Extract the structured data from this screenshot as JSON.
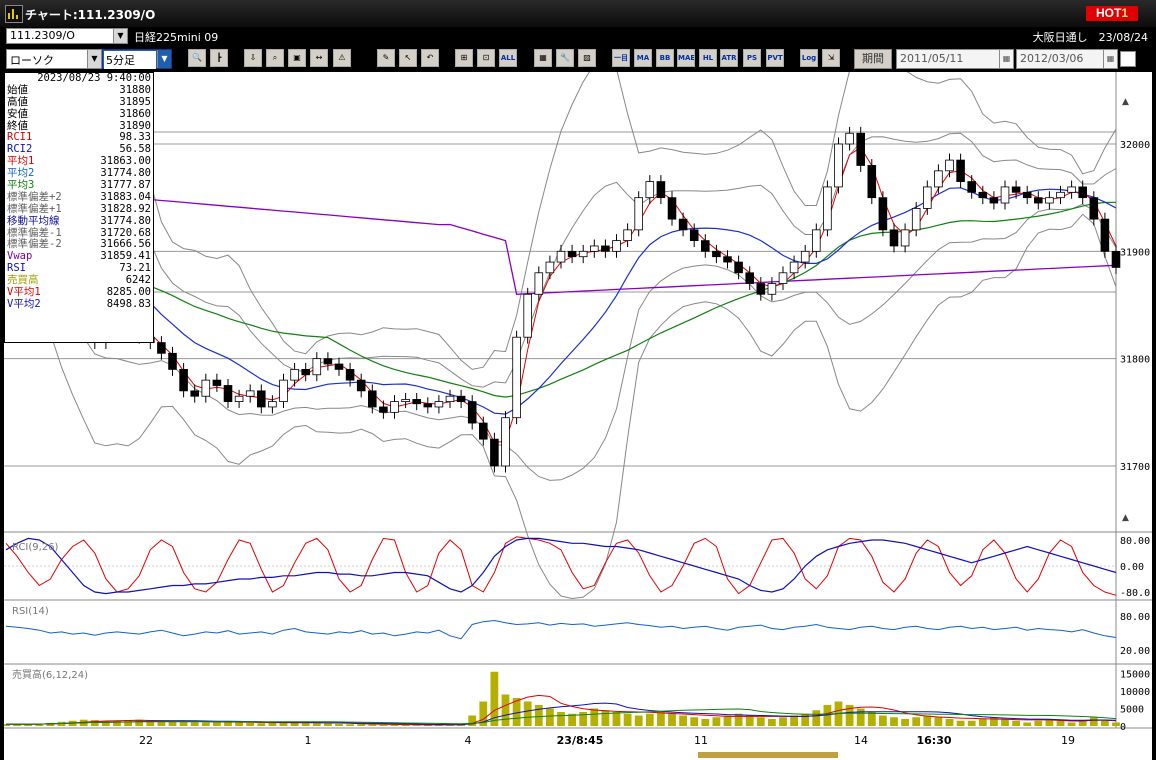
{
  "window": {
    "title": "チャート:111.2309/O",
    "hot_badge": {
      "text": "HOT",
      "number": "1"
    }
  },
  "symbol_bar": {
    "symbol": "111.2309/O",
    "name": "日経225mini 09",
    "exchange_date": "大阪日通し　23/08/24"
  },
  "toolbar": {
    "chart_type": "ローソク",
    "interval": "5分足",
    "period_label": "期間",
    "date_from": "2011/05/11",
    "date_to": "2012/03/06",
    "buttons": [
      {
        "name": "zoom-icon",
        "glyph": "🔍",
        "text": ""
      },
      {
        "name": "split-icon",
        "glyph": "┣",
        "text": ""
      },
      {
        "name": "download-icon",
        "glyph": "⇩",
        "text": ""
      },
      {
        "name": "search-chart-icon",
        "glyph": "⌕",
        "text": ""
      },
      {
        "name": "compare-icon",
        "glyph": "▣",
        "text": ""
      },
      {
        "name": "arrows-icon",
        "glyph": "↔",
        "text": ""
      },
      {
        "name": "warning-icon",
        "glyph": "⚠",
        "text": ""
      },
      {
        "name": "pencil-icon",
        "glyph": "✎",
        "text": ""
      },
      {
        "name": "cursor-icon",
        "glyph": "↖",
        "text": ""
      },
      {
        "name": "undo-icon",
        "glyph": "↶",
        "text": ""
      },
      {
        "name": "candle-a-icon",
        "glyph": "⊞",
        "text": ""
      },
      {
        "name": "candle-b-icon",
        "glyph": "⊡",
        "text": ""
      },
      {
        "name": "all-icon",
        "glyph": "",
        "text": "ALL"
      },
      {
        "name": "grid-icon",
        "glyph": "▦",
        "text": ""
      },
      {
        "name": "tools-icon",
        "glyph": "🔧",
        "text": ""
      },
      {
        "name": "palette-icon",
        "glyph": "▨",
        "text": ""
      },
      {
        "name": "indicator-icon",
        "glyph": "",
        "text": "一目"
      },
      {
        "name": "ma-icon",
        "glyph": "",
        "text": "MA"
      },
      {
        "name": "bb-icon",
        "glyph": "",
        "text": "BB"
      },
      {
        "name": "mae-icon",
        "glyph": "",
        "text": "MAE"
      },
      {
        "name": "hl-icon",
        "glyph": "",
        "text": "HL"
      },
      {
        "name": "atr-icon",
        "glyph": "",
        "text": "ATR"
      },
      {
        "name": "psar-icon",
        "glyph": "",
        "text": "PS"
      },
      {
        "name": "pvt-icon",
        "glyph": "",
        "text": "PVT"
      },
      {
        "name": "log-icon",
        "glyph": "",
        "text": "Log"
      },
      {
        "name": "export-icon",
        "glyph": "⇲",
        "text": ""
      }
    ]
  },
  "info_panel": {
    "datetime": "2023/08/23 9:40:00",
    "rows": [
      {
        "label": "始値",
        "value": "31880",
        "color": "#000000"
      },
      {
        "label": "高値",
        "value": "31895",
        "color": "#000000"
      },
      {
        "label": "安値",
        "value": "31860",
        "color": "#000000"
      },
      {
        "label": "終値",
        "value": "31890",
        "color": "#000000"
      },
      {
        "label": "RCI1",
        "value": "98.33",
        "color": "#e00000"
      },
      {
        "label": "RCI2",
        "value": "56.58",
        "color": "#1010c0"
      },
      {
        "label": "平均1",
        "value": "31863.00",
        "color": "#e00000"
      },
      {
        "label": "平均2",
        "value": "31774.80",
        "color": "#1060d0"
      },
      {
        "label": "平均3",
        "value": "31777.87",
        "color": "#108010"
      },
      {
        "label": "標準偏差+2",
        "value": "31883.04",
        "color": "#606060"
      },
      {
        "label": "標準偏差+1",
        "value": "31828.92",
        "color": "#606060"
      },
      {
        "label": "移動平均線",
        "value": "31774.80",
        "color": "#1010a0"
      },
      {
        "label": "標準偏差-1",
        "value": "31720.68",
        "color": "#606060"
      },
      {
        "label": "標準偏差-2",
        "value": "31666.56",
        "color": "#606060"
      },
      {
        "label": "Vwap",
        "value": "31859.41",
        "color": "#8000a0"
      },
      {
        "label": "RSI",
        "value": "73.21",
        "color": "#1010c0"
      },
      {
        "label": "売買高",
        "value": "6242",
        "color": "#a0a000"
      },
      {
        "label": "V平均1",
        "value": "8285.00",
        "color": "#e00000"
      },
      {
        "label": "V平均2",
        "value": "8498.83",
        "color": "#1010c0"
      }
    ]
  },
  "panels": {
    "rci_label": "RCI(9,26)",
    "rsi_label": "RSI(14)",
    "volume_label": "売買高(6,12,24)"
  },
  "axes": {
    "price_ticks": [
      "32000",
      "31900",
      "31800",
      "31700"
    ],
    "rci_ticks": [
      "80.00",
      "0.00",
      "-80.0"
    ],
    "rsi_ticks": [
      "80.00",
      "20.00"
    ],
    "volume_ticks": [
      "15000",
      "10000",
      "5000",
      "0"
    ],
    "time_labels": [
      {
        "text": "22",
        "bold": false
      },
      {
        "text": "1",
        "bold": false
      },
      {
        "text": "4",
        "bold": false
      },
      {
        "text": "23/8:45",
        "bold": true
      },
      {
        "text": "11",
        "bold": false
      },
      {
        "text": "14",
        "bold": false
      },
      {
        "text": "16:30",
        "bold": true
      },
      {
        "text": "19",
        "bold": false
      }
    ]
  },
  "chart_data": {
    "type": "candlestick",
    "ylim": [
      31660,
      32070
    ],
    "price_close_path": [
      31965,
      31955,
      31935,
      31900,
      31880,
      31860,
      31845,
      31830,
      31815,
      31840,
      31850,
      31835,
      31820,
      31815,
      31805,
      31790,
      31770,
      31765,
      31780,
      31775,
      31760,
      31765,
      31770,
      31755,
      31760,
      31780,
      31790,
      31785,
      31800,
      31795,
      31790,
      31780,
      31770,
      31755,
      31750,
      31760,
      31762,
      31758,
      31755,
      31760,
      31765,
      31760,
      31740,
      31725,
      31700,
      31745,
      31820,
      31860,
      31880,
      31890,
      31900,
      31895,
      31900,
      31905,
      31900,
      31910,
      31920,
      31950,
      31965,
      31950,
      31930,
      31920,
      31910,
      31900,
      31895,
      31890,
      31880,
      31870,
      31860,
      31870,
      31880,
      31890,
      31900,
      31920,
      31960,
      32000,
      32010,
      31980,
      31950,
      31920,
      31905,
      31920,
      31940,
      31960,
      31975,
      31985,
      31965,
      31955,
      31950,
      31945,
      31960,
      31955,
      31950,
      31945,
      31950,
      31955,
      31960,
      31950,
      31930,
      31900,
      31885
    ],
    "volume_path": [
      500,
      600,
      400,
      700,
      900,
      1200,
      1500,
      1800,
      1700,
      1400,
      1500,
      1600,
      1800,
      1500,
      1400,
      1300,
      1200,
      1100,
      1000,
      1100,
      1200,
      1000,
      900,
      800,
      900,
      1000,
      1100,
      900,
      800,
      700,
      600,
      500,
      500,
      400,
      300,
      400,
      300,
      200,
      300,
      400,
      300,
      500,
      3000,
      7000,
      15500,
      9000,
      8000,
      7000,
      6000,
      5000,
      4000,
      3500,
      4000,
      5000,
      4500,
      4000,
      3500,
      3000,
      3500,
      4000,
      3500,
      3000,
      2500,
      2000,
      2500,
      3000,
      3500,
      3000,
      2500,
      2000,
      2500,
      3000,
      3500,
      4500,
      6000,
      7000,
      6000,
      5000,
      4000,
      3000,
      2500,
      2000,
      2500,
      3000,
      2500,
      2000,
      1500,
      1500,
      2000,
      2500,
      2000,
      1500,
      1000,
      1500,
      2000,
      1500,
      1000,
      1500,
      2500,
      1500,
      1000
    ],
    "rsi_path": [
      62,
      60,
      58,
      55,
      50,
      52,
      48,
      50,
      46,
      50,
      52,
      50,
      48,
      52,
      55,
      50,
      45,
      48,
      52,
      50,
      54,
      48,
      50,
      52,
      48,
      55,
      58,
      52,
      50,
      48,
      52,
      50,
      54,
      48,
      50,
      45,
      48,
      52,
      50,
      55,
      45,
      40,
      65,
      70,
      72,
      68,
      65,
      66,
      68,
      64,
      67,
      65,
      66,
      62,
      64,
      66,
      68,
      65,
      63,
      60,
      62,
      58,
      60,
      62,
      58,
      55,
      60,
      62,
      64,
      58,
      56,
      60,
      62,
      65,
      60,
      58,
      56,
      60,
      62,
      58,
      56,
      60,
      62,
      58,
      56,
      60,
      62,
      58,
      60,
      56,
      58,
      60,
      55,
      58,
      56,
      55,
      52,
      56,
      50,
      45,
      42
    ],
    "rci1_path": [
      70,
      30,
      -20,
      -60,
      -40,
      20,
      60,
      80,
      40,
      -40,
      -80,
      -70,
      -30,
      50,
      80,
      60,
      -20,
      -70,
      -80,
      -50,
      20,
      80,
      70,
      -10,
      -80,
      -60,
      10,
      70,
      85,
      50,
      -40,
      -80,
      -60,
      20,
      85,
      80,
      -20,
      -80,
      -60,
      40,
      80,
      50,
      -60,
      -80,
      -20,
      70,
      90,
      85,
      80,
      70,
      50,
      -20,
      -70,
      -60,
      10,
      70,
      80,
      40,
      -30,
      -80,
      -60,
      0,
      70,
      85,
      60,
      -40,
      -85,
      -60,
      10,
      80,
      85,
      40,
      -40,
      -70,
      -30,
      60,
      85,
      80,
      30,
      -50,
      -80,
      -40,
      40,
      80,
      60,
      -20,
      -60,
      -30,
      50,
      80,
      40,
      -40,
      -80,
      -40,
      40,
      80,
      60,
      -20,
      -60,
      -80,
      -90
    ],
    "rci2_path": [
      50,
      70,
      85,
      80,
      60,
      20,
      -20,
      -60,
      -80,
      -85,
      -80,
      -80,
      -75,
      -70,
      -65,
      -60,
      -60,
      -55,
      -55,
      -50,
      -45,
      -40,
      -40,
      -35,
      -35,
      -30,
      -30,
      -25,
      -20,
      -20,
      -25,
      -25,
      -30,
      -30,
      -25,
      -20,
      -20,
      -25,
      -30,
      -50,
      -70,
      -80,
      -60,
      -20,
      30,
      60,
      80,
      85,
      85,
      80,
      75,
      70,
      70,
      65,
      60,
      60,
      55,
      50,
      40,
      30,
      20,
      10,
      0,
      -10,
      -20,
      -30,
      -40,
      -60,
      -75,
      -80,
      -70,
      -40,
      0,
      30,
      50,
      60,
      70,
      75,
      80,
      80,
      75,
      70,
      60,
      50,
      40,
      30,
      20,
      10,
      20,
      30,
      40,
      50,
      60,
      50,
      40,
      30,
      20,
      10,
      0,
      -10,
      -20
    ],
    "series": [
      {
        "name": "平均1",
        "color": "#e00000"
      },
      {
        "name": "平均2",
        "color": "#1a2fd0"
      },
      {
        "name": "平均3",
        "color": "#108010"
      },
      {
        "name": "Vwap",
        "color": "#8a00c0"
      },
      {
        "name": "標準偏差",
        "color": "#707070"
      }
    ]
  }
}
